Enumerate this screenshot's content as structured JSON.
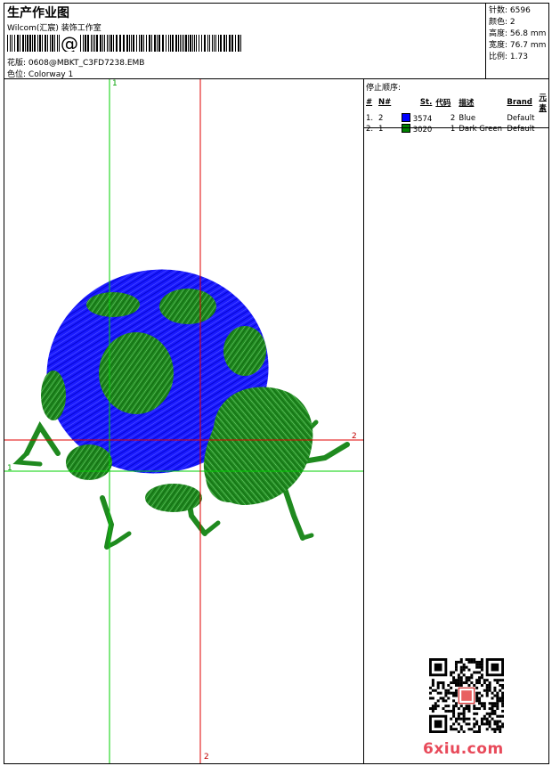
{
  "header": {
    "title": "生产作业图",
    "studio": "Wilcom(汇宸) 装饰工作室",
    "barcode_symbol": "@",
    "design_label": "花版:",
    "design_value": "0608@MBKT_C3FD7238.EMB",
    "colorway_label": "色位:",
    "colorway_value": "Colorway 1"
  },
  "stats": [
    {
      "label": "针数:",
      "value": "6596"
    },
    {
      "label": "颜色:",
      "value": "2"
    },
    {
      "label": "高度:",
      "value": "56.8 mm"
    },
    {
      "label": "宽度:",
      "value": "76.7 mm"
    },
    {
      "label": "比例:",
      "value": "1.73"
    }
  ],
  "stop_sequence": {
    "title": "停止顺序:",
    "columns": [
      "#",
      "N#",
      "St.",
      "代码",
      "描述",
      "Brand",
      "元素"
    ],
    "rows": [
      {
        "index": "1.",
        "n": "2",
        "stitches": "3574",
        "code": "2",
        "description": "Blue",
        "brand": "Default",
        "color": "#0000ff"
      },
      {
        "index": "2.",
        "n": "1",
        "stitches": "3020",
        "code": "1",
        "description": "Dark Green",
        "brand": "Default",
        "color": "#008000"
      }
    ]
  },
  "guides": {
    "green_label_top": "1",
    "green_label_left": "1",
    "red_label_right": "2",
    "red_label_bottom": "2"
  },
  "watermark": "6xiu.com",
  "colors": {
    "blue": "#1a1aff",
    "green": "#1f8a1f",
    "guide_green": "#00d000",
    "guide_red": "#e00000"
  }
}
